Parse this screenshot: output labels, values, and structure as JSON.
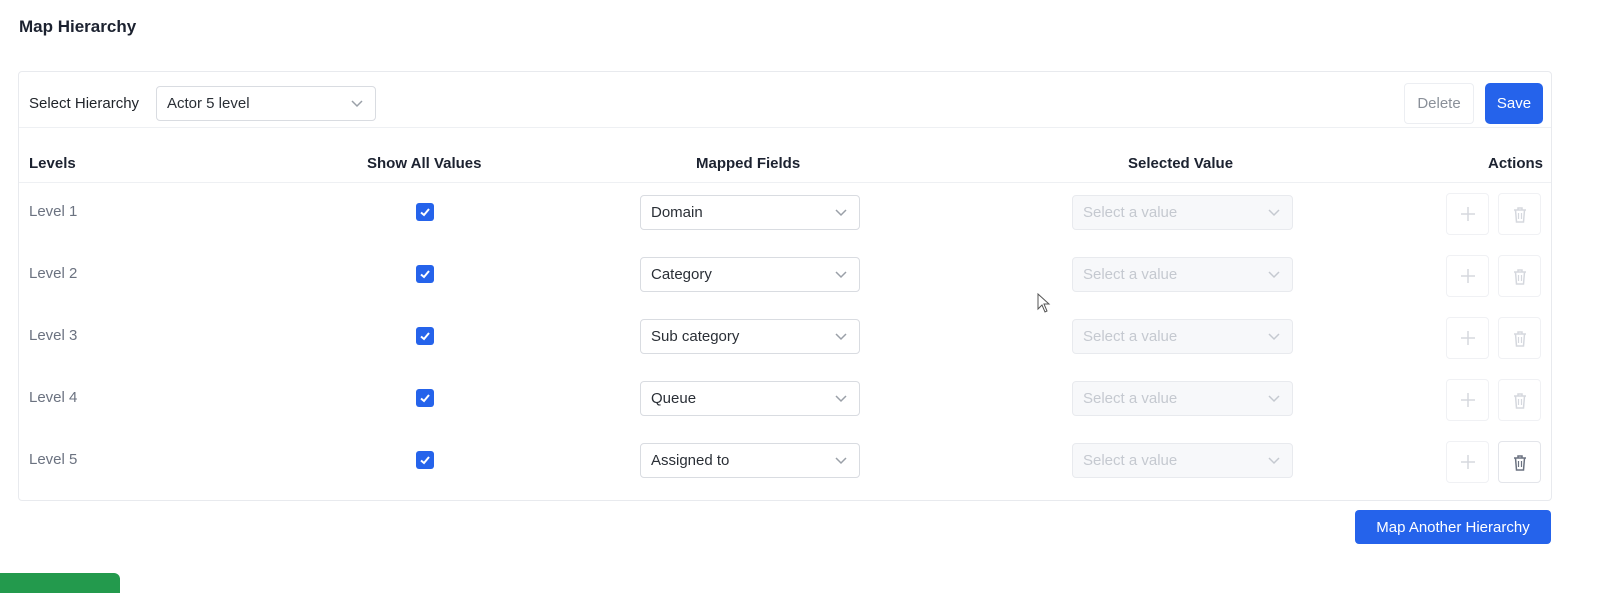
{
  "page": {
    "title": "Map Hierarchy"
  },
  "toolbar": {
    "select_label": "Select Hierarchy",
    "hierarchy_value": "Actor 5 level",
    "delete_label": "Delete",
    "save_label": "Save"
  },
  "table": {
    "headers": {
      "levels": "Levels",
      "show_all": "Show All Values",
      "mapped": "Mapped Fields",
      "selected": "Selected Value",
      "actions": "Actions"
    },
    "rows": [
      {
        "level": "Level 1",
        "show_all": true,
        "mapped": "Domain",
        "selected_placeholder": "Select a value"
      },
      {
        "level": "Level 2",
        "show_all": true,
        "mapped": "Category",
        "selected_placeholder": "Select a value"
      },
      {
        "level": "Level 3",
        "show_all": true,
        "mapped": "Sub category",
        "selected_placeholder": "Select a value"
      },
      {
        "level": "Level 4",
        "show_all": true,
        "mapped": "Queue",
        "selected_placeholder": "Select a value"
      },
      {
        "level": "Level 5",
        "show_all": true,
        "mapped": "Assigned to",
        "selected_placeholder": "Select a value"
      }
    ]
  },
  "footer": {
    "map_another_label": "Map Another Hierarchy"
  },
  "colors": {
    "accent": "#2563eb",
    "green": "#239a4d"
  }
}
